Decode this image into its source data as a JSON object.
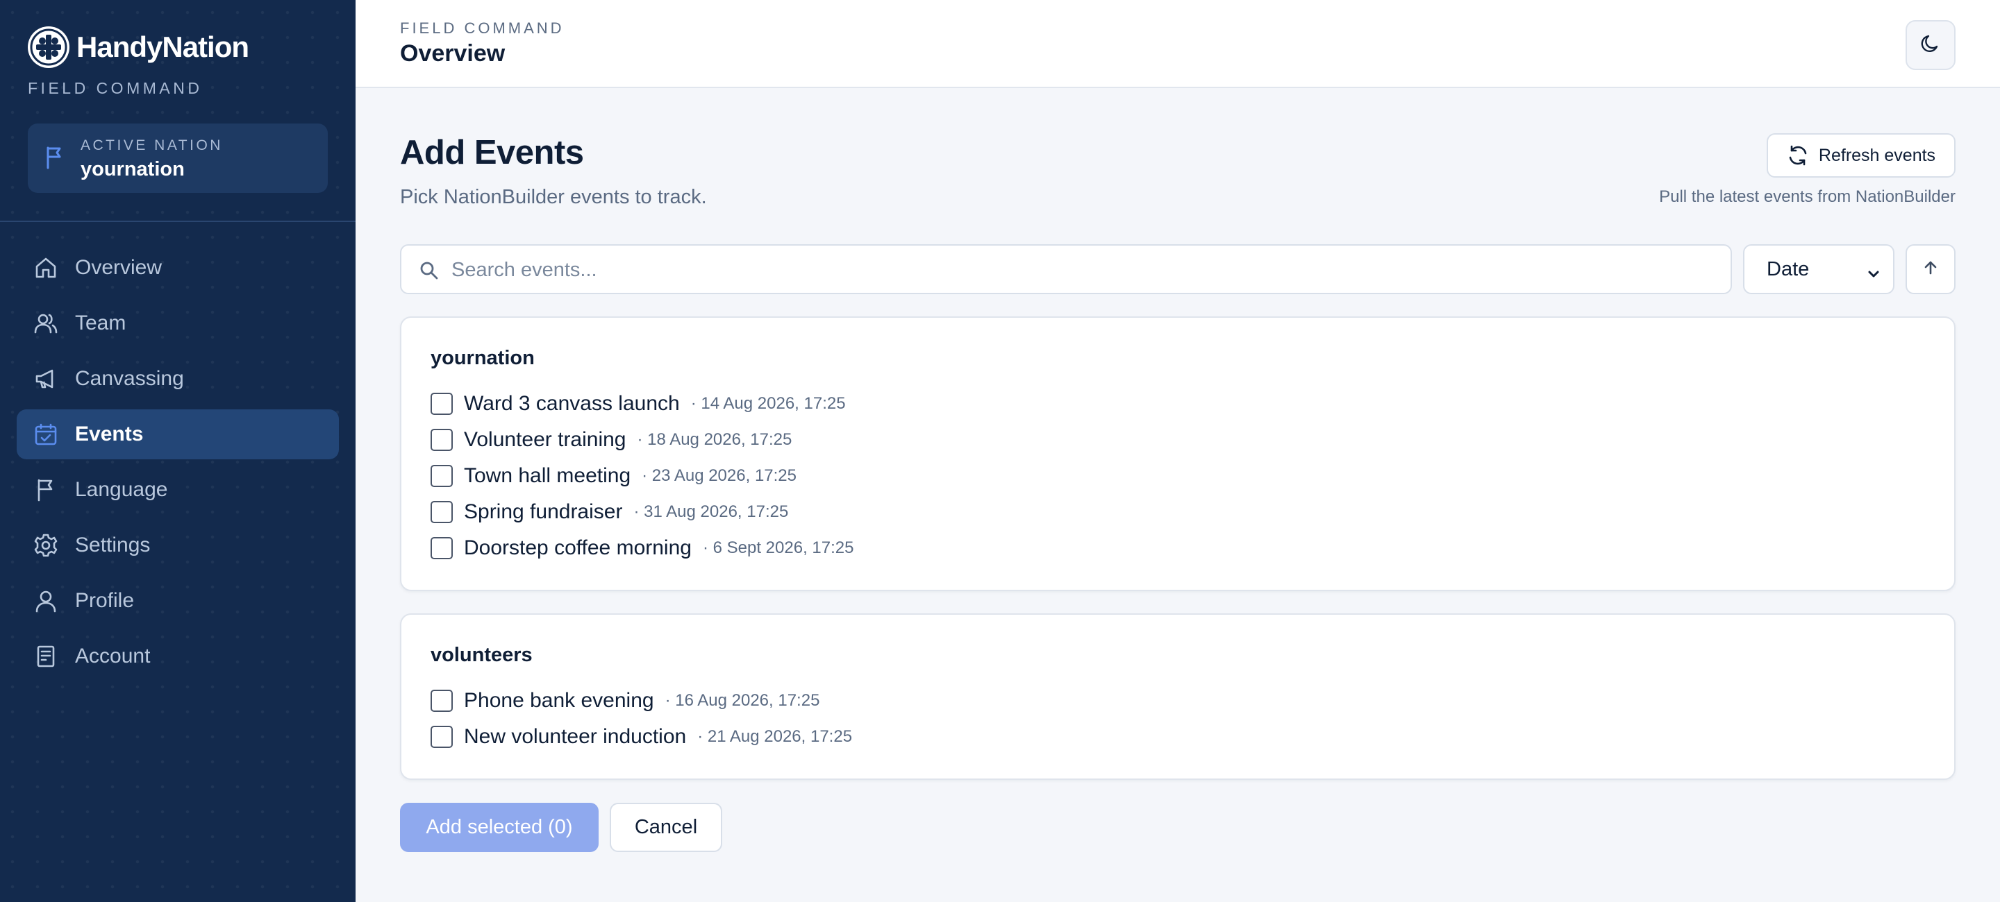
{
  "brand": {
    "name": "HandyNation",
    "subtitle": "FIELD COMMAND"
  },
  "active_nation": {
    "label": "ACTIVE NATION",
    "value": "yournation"
  },
  "nav": [
    {
      "label": "Overview",
      "icon": "home-icon"
    },
    {
      "label": "Team",
      "icon": "users-icon"
    },
    {
      "label": "Canvassing",
      "icon": "megaphone-icon"
    },
    {
      "label": "Events",
      "icon": "calendar-check-icon",
      "active": true
    },
    {
      "label": "Language",
      "icon": "flag-icon"
    },
    {
      "label": "Settings",
      "icon": "gear-icon"
    },
    {
      "label": "Profile",
      "icon": "user-icon"
    },
    {
      "label": "Account",
      "icon": "receipt-icon"
    }
  ],
  "header": {
    "kicker": "FIELD COMMAND",
    "title": "Overview",
    "theme_icon": "moon-icon"
  },
  "main": {
    "title": "Add Events",
    "subtitle": "Pick NationBuilder events to track.",
    "refresh_label": "Refresh events",
    "refresh_hint": "Pull the latest events from NationBuilder",
    "search_placeholder": "Search events...",
    "search_value": "",
    "sort_value": "Date",
    "sort_direction_icon": "arrow-up-icon"
  },
  "groups": [
    {
      "name": "yournation",
      "events": [
        {
          "name": "Ward 3 canvass launch",
          "date": "· 14 Aug 2026, 17:25",
          "checked": false
        },
        {
          "name": "Volunteer training",
          "date": "· 18 Aug 2026, 17:25",
          "checked": false
        },
        {
          "name": "Town hall meeting",
          "date": "· 23 Aug 2026, 17:25",
          "checked": false
        },
        {
          "name": "Spring fundraiser",
          "date": "· 31 Aug 2026, 17:25",
          "checked": false
        },
        {
          "name": "Doorstep coffee morning",
          "date": "· 6 Sept 2026, 17:25",
          "checked": false
        }
      ]
    },
    {
      "name": "volunteers",
      "events": [
        {
          "name": "Phone bank evening",
          "date": "· 16 Aug 2026, 17:25",
          "checked": false
        },
        {
          "name": "New volunteer induction",
          "date": "· 21 Aug 2026, 17:25",
          "checked": false
        }
      ]
    }
  ],
  "actions": {
    "add_label": "Add selected (0)",
    "cancel_label": "Cancel"
  },
  "colors": {
    "sidebar": "#132a4d",
    "nav_active": "#234677",
    "primary_disabled": "#8fa9ee",
    "accent_icon": "#5b8def"
  }
}
